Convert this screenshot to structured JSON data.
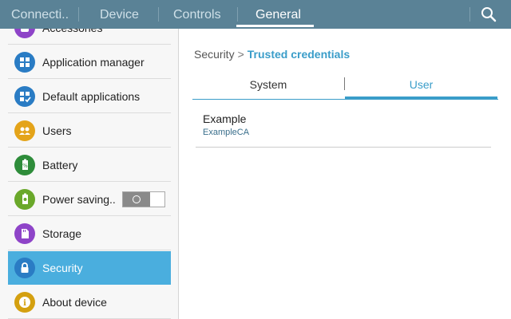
{
  "header": {
    "tabs": [
      {
        "label": "Connecti.."
      },
      {
        "label": "Device"
      },
      {
        "label": "Controls"
      },
      {
        "label": "General"
      }
    ],
    "selected_tab": "General"
  },
  "sidebar": {
    "items": [
      {
        "label": "Accessories",
        "icon": "accessories-icon",
        "color": "#8e44c8"
      },
      {
        "label": "Application manager",
        "icon": "grid-icon",
        "color": "#2a7cc4"
      },
      {
        "label": "Default applications",
        "icon": "default-apps-icon",
        "color": "#2a7cc4"
      },
      {
        "label": "Users",
        "icon": "users-icon",
        "color": "#e4a41a"
      },
      {
        "label": "Battery",
        "icon": "battery-icon",
        "color": "#2e8c3a"
      },
      {
        "label": "Power saving..",
        "icon": "power-saving-icon",
        "color": "#6aa82a",
        "toggle": "off"
      },
      {
        "label": "Storage",
        "icon": "storage-icon",
        "color": "#8e44c8"
      },
      {
        "label": "Security",
        "icon": "lock-icon",
        "color": "#2a7cc4"
      },
      {
        "label": "About device",
        "icon": "info-icon",
        "color": "#d4a010"
      }
    ],
    "selected_item": "Security"
  },
  "main": {
    "breadcrumb": {
      "parent": "Security",
      "separator": ">",
      "current": "Trusted credentials"
    },
    "tabs": [
      {
        "label": "System"
      },
      {
        "label": "User"
      }
    ],
    "selected_tab": "User",
    "credentials": [
      {
        "name": "Example",
        "organization": "ExampleCA"
      }
    ]
  },
  "colors": {
    "header_bg": "#5a8296",
    "accent": "#3a9dc9",
    "selection": "#4aaede"
  }
}
